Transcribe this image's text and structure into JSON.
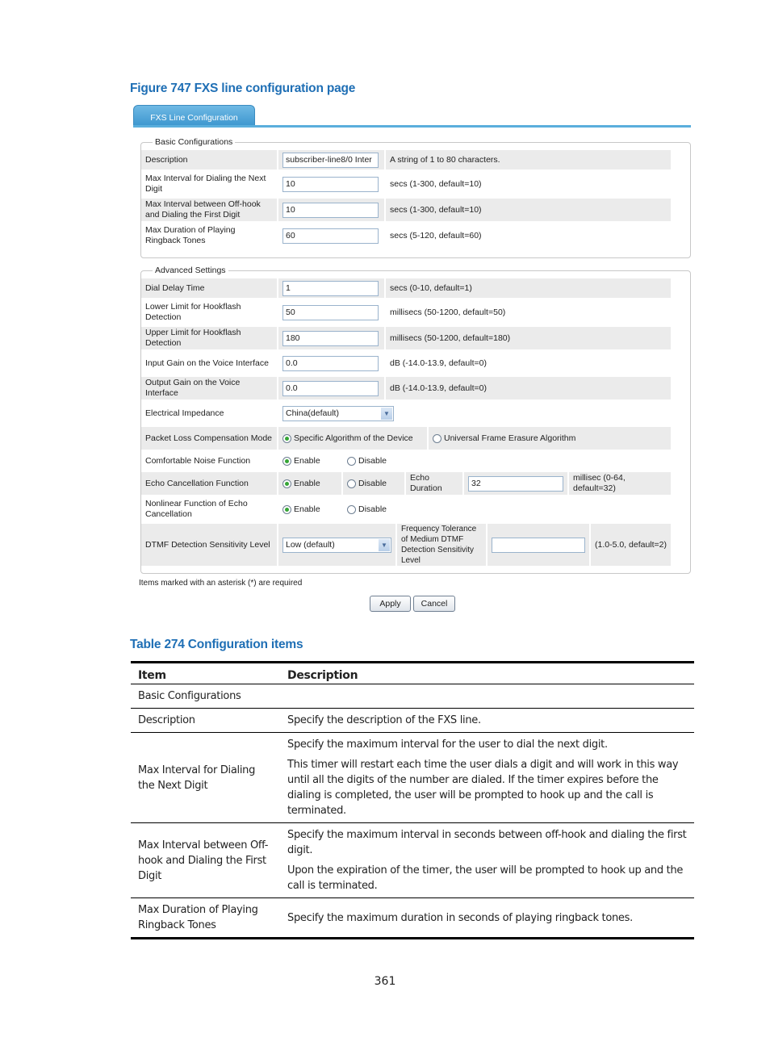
{
  "figure_caption": "Figure 747 FXS line configuration page",
  "screenshot": {
    "tab_label": "FXS Line Configuration",
    "basic": {
      "legend": "Basic Configurations",
      "rows": [
        {
          "label": "Description",
          "value": "subscriber-line8/0 Inter",
          "hint": "A string of 1 to 80 characters."
        },
        {
          "label": "Max Interval for Dialing the Next Digit",
          "value": "10",
          "hint": "secs (1-300, default=10)"
        },
        {
          "label": "Max Interval between Off-hook and Dialing the First Digit",
          "value": "10",
          "hint": "secs (1-300, default=10)"
        },
        {
          "label": "Max Duration of Playing Ringback Tones",
          "value": "60",
          "hint": "secs (5-120, default=60)"
        }
      ]
    },
    "advanced": {
      "legend": "Advanced Settings",
      "rows": [
        {
          "label": "Dial Delay Time",
          "value": "1",
          "hint": "secs (0-10, default=1)"
        },
        {
          "label": "Lower Limit for Hookflash Detection",
          "value": "50",
          "hint": "millisecs (50-1200, default=50)"
        },
        {
          "label": "Upper Limit for Hookflash Detection",
          "value": "180",
          "hint": "millisecs (50-1200, default=180)"
        },
        {
          "label": "Input Gain on the Voice Interface",
          "value": "0.0",
          "hint": "dB (-14.0-13.9, default=0)"
        },
        {
          "label": "Output Gain on the Voice Interface",
          "value": "0.0",
          "hint": "dB (-14.0-13.9, default=0)"
        }
      ],
      "impedance": {
        "label": "Electrical Impedance",
        "selected": "China(default)"
      },
      "plc": {
        "label": "Packet Loss Compensation Mode",
        "option1": "Specific Algorithm of the Device",
        "option2": "Universal Frame Erasure Algorithm",
        "selected": "option1"
      },
      "cng": {
        "label": "Comfortable Noise Function",
        "enable": "Enable",
        "disable": "Disable",
        "selected": "enable"
      },
      "echo": {
        "label": "Echo Cancellation Function",
        "enable": "Enable",
        "disable": "Disable",
        "selected": "enable",
        "duration_label": "Echo Duration",
        "duration_value": "32",
        "duration_hint": "millisec (0-64, default=32)"
      },
      "nlp": {
        "label": "Nonlinear Function of Echo Cancellation",
        "enable": "Enable",
        "disable": "Disable",
        "selected": "enable"
      },
      "dtmf": {
        "label": "DTMF Detection Sensitivity Level",
        "selected": "Low (default)",
        "tolerance_label": "Frequency Tolerance of Medium DTMF Detection Sensitivity Level",
        "tolerance_value": "",
        "tolerance_hint": "(1.0-5.0, default=2)"
      }
    },
    "required_note": "Items marked with an asterisk (*) are required",
    "apply_label": "Apply",
    "cancel_label": "Cancel"
  },
  "table_caption": "Table 274 Configuration items",
  "table": {
    "headers": [
      "Item",
      "Description"
    ],
    "rows": [
      {
        "item": "Basic Configurations",
        "desc": []
      },
      {
        "item": "Description",
        "desc": [
          "Specify the description of the FXS line."
        ]
      },
      {
        "item": "Max Interval for Dialing the Next Digit",
        "desc": [
          "Specify the maximum interval for the user to dial the next digit.",
          "This timer will restart each time the user dials a digit and will work in this way until all the digits of the number are dialed. If the timer expires before the dialing is completed, the user will be prompted to hook up and the call is terminated."
        ]
      },
      {
        "item": "Max Interval between Off-hook and Dialing the First Digit",
        "desc": [
          "Specify the maximum interval in seconds between off-hook and dialing the first digit.",
          "Upon the expiration of the timer, the user will be prompted to hook up and the call is terminated."
        ]
      },
      {
        "item": "Max Duration of Playing Ringback Tones",
        "desc": [
          "Specify the maximum duration in seconds of playing ringback tones."
        ]
      }
    ]
  },
  "page_number": "361"
}
